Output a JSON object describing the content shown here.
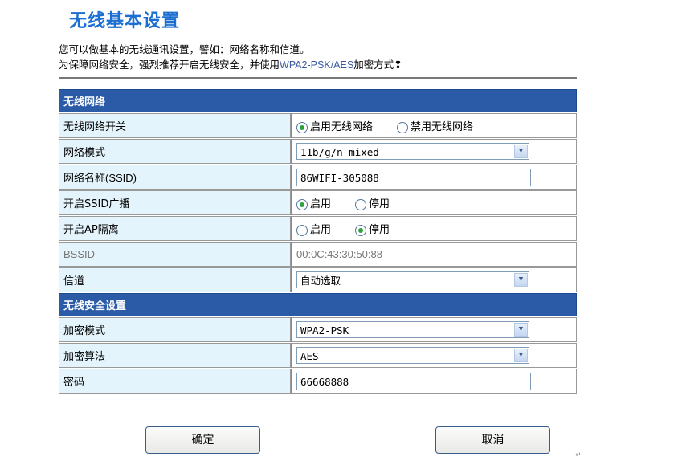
{
  "title": "无线基本设置",
  "desc": {
    "line1": "您可以做基本的无线通讯设置，譬如：网络名称和信道。",
    "line2_pre": "为保障网络安全，强烈推荐开启无线安全，并使用",
    "line2_hl": "WPA2-PSK/AES",
    "line2_post": "加密方式❢"
  },
  "wireless": {
    "section": "无线网络",
    "switch": {
      "label": "无线网络开关",
      "opt_on": "启用无线网络",
      "opt_off": "禁用无线网络",
      "selected": "on"
    },
    "mode": {
      "label": "网络模式",
      "value": "11b/g/n mixed"
    },
    "ssid": {
      "label": "网络名称(SSID)",
      "value": "86WIFI-305088"
    },
    "broadcast": {
      "label": "开启SSID广播",
      "opt_on": "启用",
      "opt_off": "停用",
      "selected": "on"
    },
    "isolation": {
      "label": "开启AP隔离",
      "opt_on": "启用",
      "opt_off": "停用",
      "selected": "off"
    },
    "bssid": {
      "label": "BSSID",
      "value": "00:0C:43:30:50:88"
    },
    "channel": {
      "label": "信道",
      "value": "自动选取"
    }
  },
  "security": {
    "section": "无线安全设置",
    "mode": {
      "label": "加密模式",
      "value": "WPA2-PSK"
    },
    "algorithm": {
      "label": "加密算法",
      "value": "AES"
    },
    "password": {
      "label": "密码",
      "value": "66668888"
    }
  },
  "buttons": {
    "ok": "确定",
    "cancel": "取消"
  },
  "mark": "↵"
}
